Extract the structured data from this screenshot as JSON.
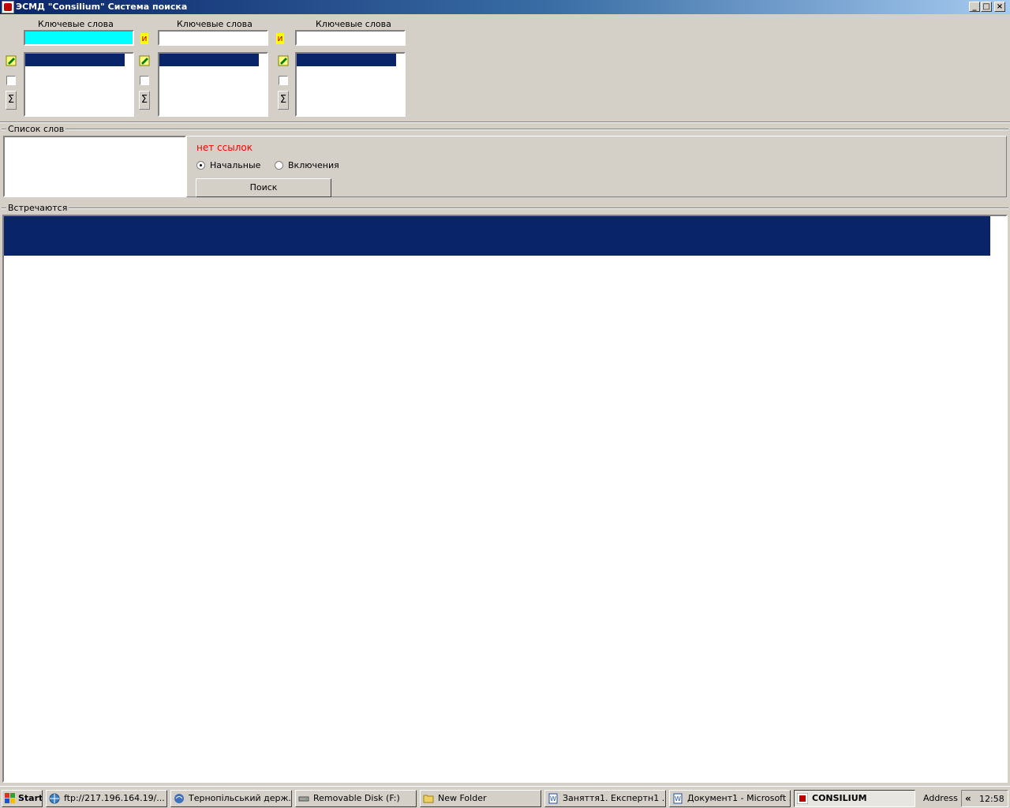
{
  "window": {
    "title": "ЭСМД  \"Consilium\" Система поиска",
    "controls": [
      "_",
      "□",
      "×"
    ]
  },
  "keywords": {
    "label": "Ключевые слова",
    "and_label": "и",
    "columns": [
      {
        "value": "",
        "highlighted": true
      },
      {
        "value": ""
      },
      {
        "value": ""
      }
    ]
  },
  "word_list": {
    "group_title": "Список слов",
    "status": "нет ссылок",
    "radio_initial": "Начальные",
    "radio_inclusion": "Включения",
    "search_button": "Поиск"
  },
  "results": {
    "group_title": "Встречаются"
  },
  "colors": {
    "accent_cyan": "#00ffff",
    "selection_navy": "#0a246a",
    "status_red": "#ff0000",
    "and_yellow": "#ffff00"
  },
  "taskbar": {
    "start": "Start",
    "tasks": [
      {
        "label": "ftp://217.196.164.19/..."
      },
      {
        "label": "Тернопільський держ..."
      },
      {
        "label": "Removable Disk (F:)"
      },
      {
        "label": "New Folder"
      },
      {
        "label": "Заняття1. Експертн1 ..."
      },
      {
        "label": "Документ1 - Microsoft ..."
      },
      {
        "label": "CONSILIUM"
      }
    ],
    "address_label": "Address",
    "chevron": "«",
    "clock": "12:58"
  }
}
